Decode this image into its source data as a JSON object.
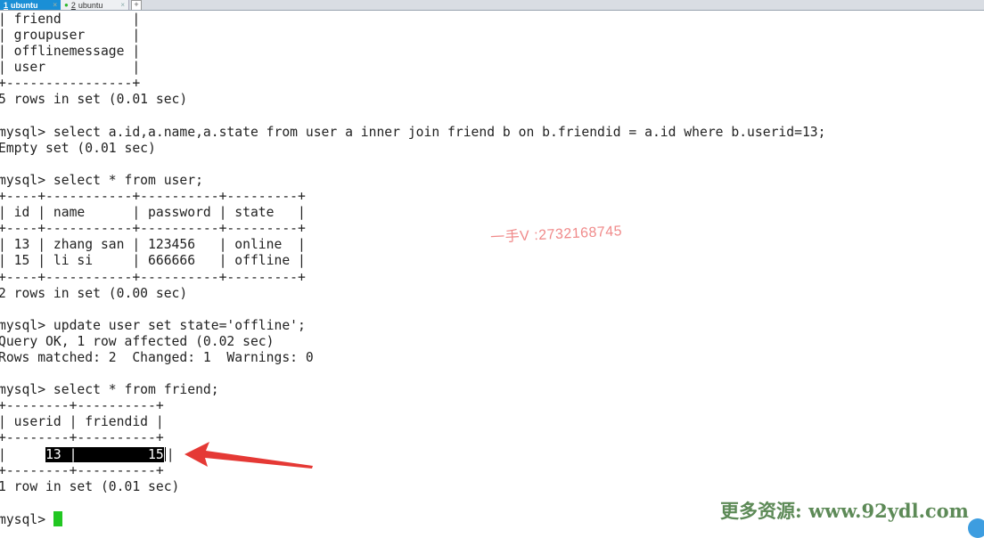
{
  "tabs": [
    {
      "number": "1",
      "label": "ubuntu",
      "active": true
    },
    {
      "number": "2",
      "label": "ubuntu",
      "active": false
    }
  ],
  "tab_close": "×",
  "tab_add": "+",
  "terminal": {
    "lines": [
      "| friend         |",
      "| groupuser      |",
      "| offlinemessage |",
      "| user           |",
      "+----------------+",
      "5 rows in set (0.01 sec)",
      "",
      "mysql> select a.id,a.name,a.state from user a inner join friend b on b.friendid = a.id where b.userid=13;",
      "Empty set (0.01 sec)",
      "",
      "mysql> select * from user;",
      "+----+-----------+----------+---------+",
      "| id | name      | password | state   |",
      "+----+-----------+----------+---------+",
      "| 13 | zhang san | 123456   | online  |",
      "| 15 | li si     | 666666   | offline |",
      "+----+-----------+----------+---------+",
      "2 rows in set (0.00 sec)",
      "",
      "mysql> update user set state='offline';",
      "Query OK, 1 row affected (0.02 sec)",
      "Rows matched: 2  Changed: 1  Warnings: 0",
      "",
      "mysql> select * from friend;",
      "+--------+----------+",
      "| userid | friendid |",
      "+--------+----------+"
    ],
    "selected_row": {
      "prefix": "|     ",
      "selected": "13 |         15",
      "suffix": "|"
    },
    "after_lines": [
      "+--------+----------+",
      "1 row in set (0.01 sec)",
      ""
    ],
    "prompt": "mysql> "
  },
  "watermark": "一手V :2732168745",
  "site_banner": "更多资源: www.92ydl.com",
  "colors": {
    "cursor": "#22c722",
    "arrow": "#e53935",
    "tab_active": "#1a8fd6"
  }
}
